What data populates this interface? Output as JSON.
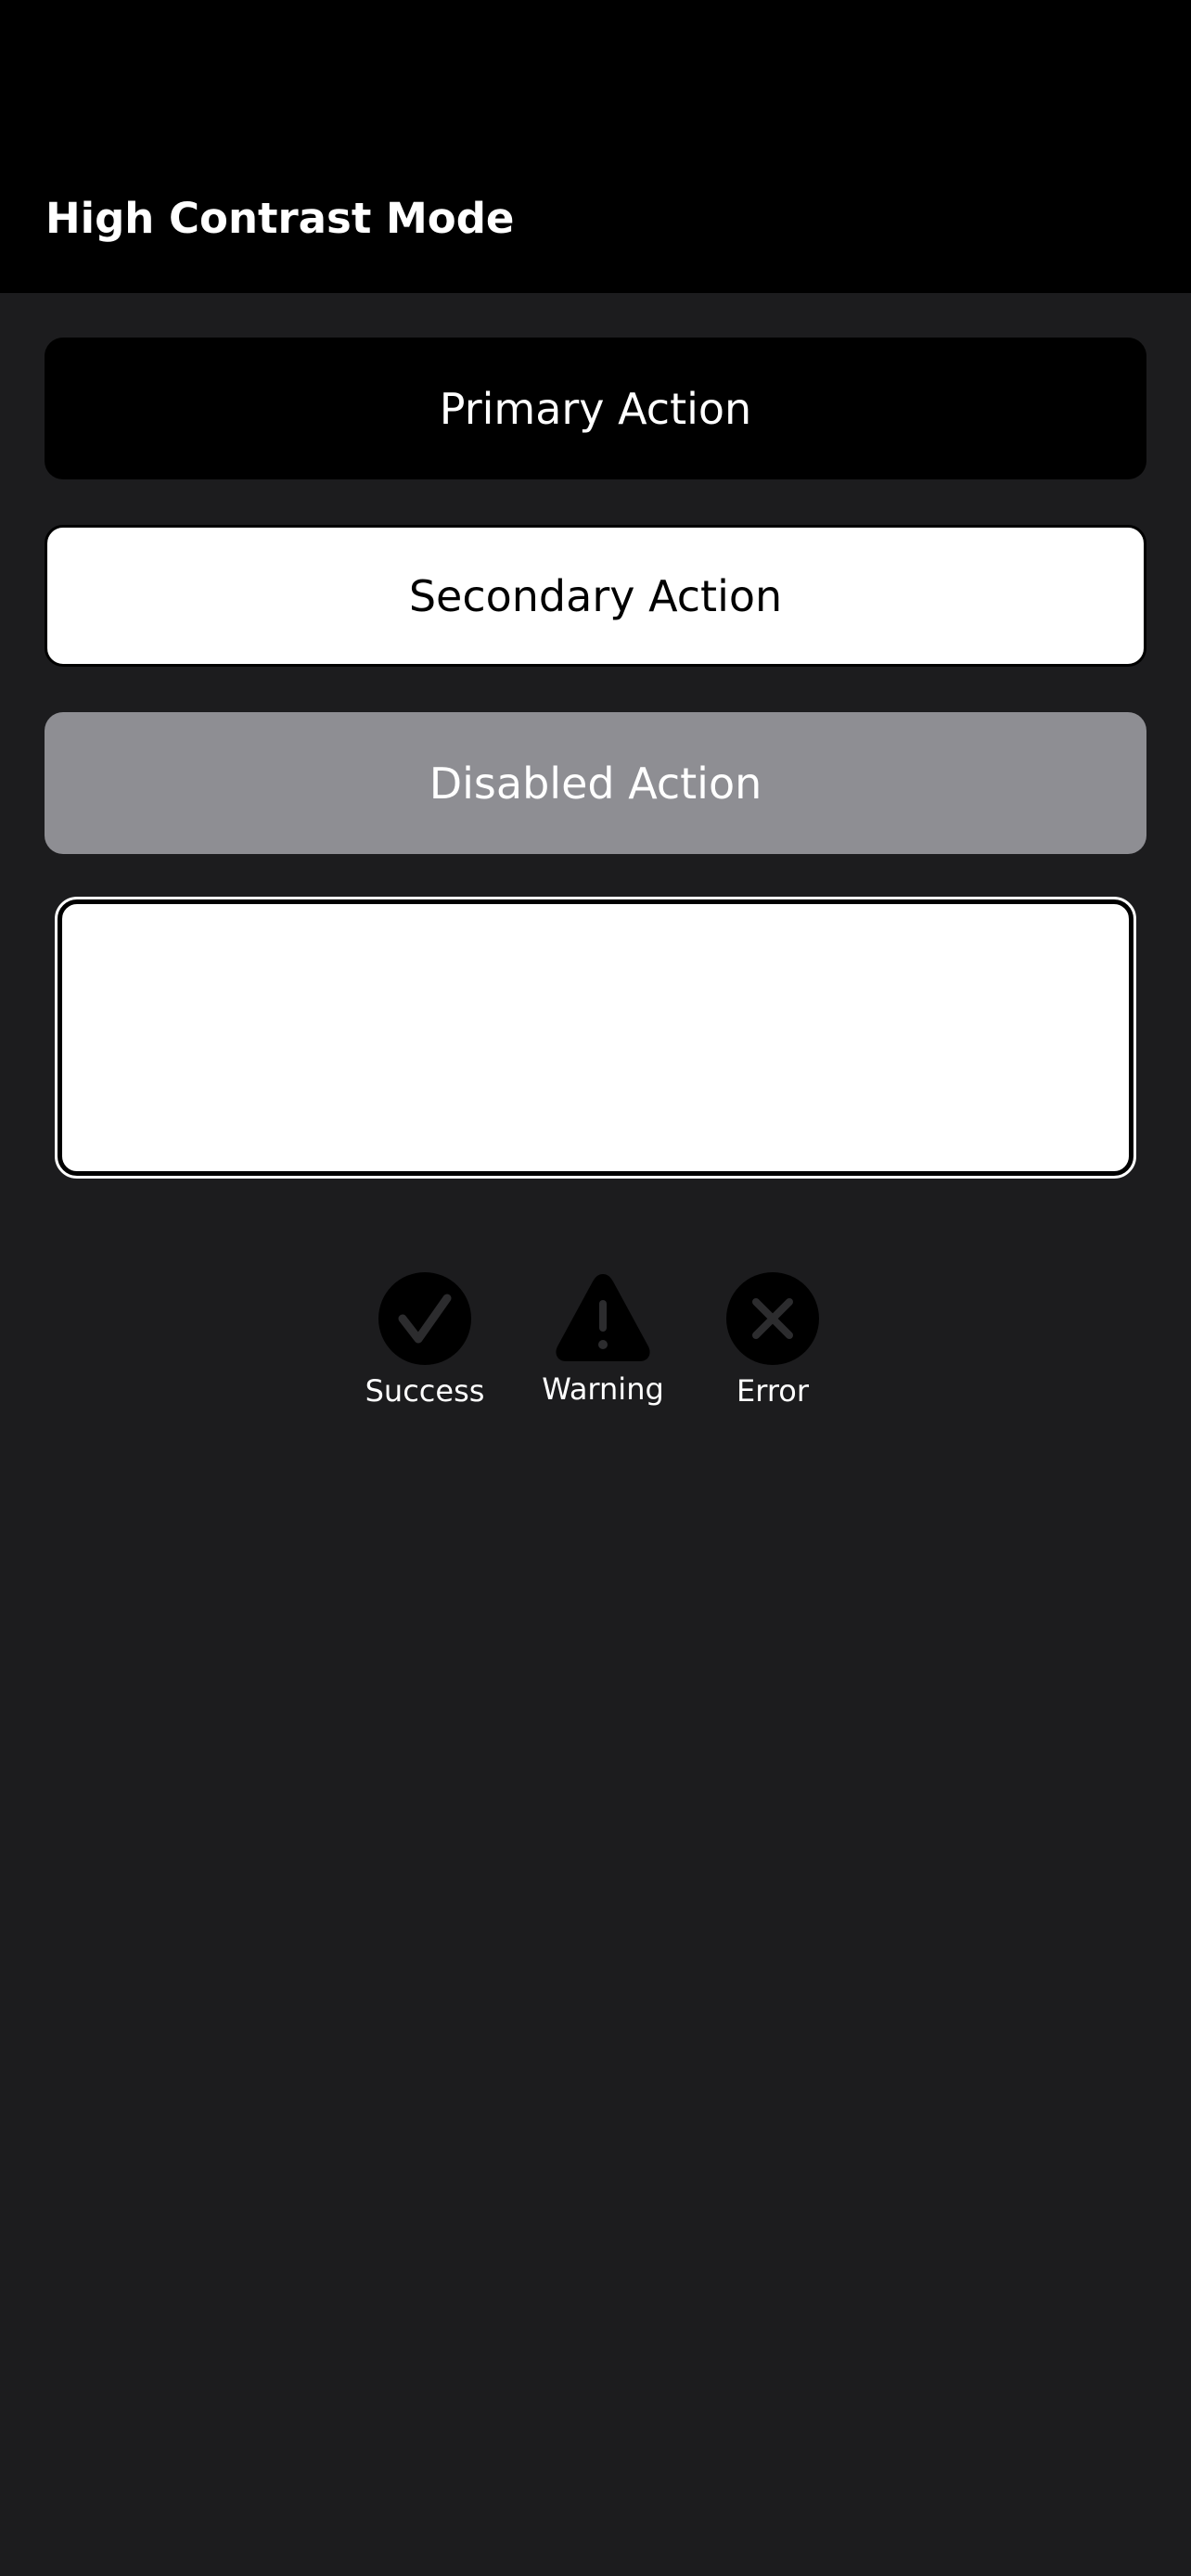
{
  "header": {
    "title": "High Contrast Mode"
  },
  "buttons": {
    "primary_label": "Primary Action",
    "secondary_label": "Secondary Action",
    "disabled_label": "Disabled Action"
  },
  "text_field": {
    "value": ""
  },
  "status_indicators": [
    {
      "label": "Success",
      "icon": "checkmark-icon"
    },
    {
      "label": "Warning",
      "icon": "warning-icon"
    },
    {
      "label": "Error",
      "icon": "close-icon"
    }
  ],
  "colors": {
    "background": "#1c1c1e",
    "nav_background": "#000000",
    "primary_button": "#000000",
    "secondary_button": "#ffffff",
    "disabled_button": "#8e8e93",
    "text_light": "#ffffff",
    "text_dark": "#000000"
  }
}
